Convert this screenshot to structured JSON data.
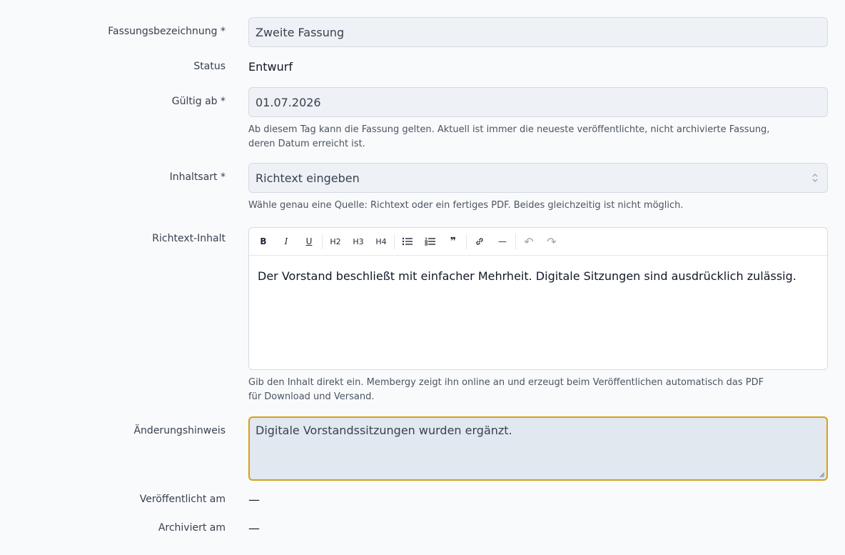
{
  "fields": {
    "name": {
      "label": "Fassungsbezeichnung *",
      "value": "Zweite Fassung"
    },
    "status": {
      "label": "Status",
      "value": "Entwurf"
    },
    "valid_from": {
      "label": "Gültig ab *",
      "value": "01.07.2026",
      "help_line1": "Ab diesem Tag kann die Fassung gelten. Aktuell ist immer die neueste veröffentlichte, nicht archivierte Fassung,",
      "help_line2": "deren Datum erreicht ist."
    },
    "content_type": {
      "label": "Inhaltsart *",
      "value": "Richtext eingeben",
      "help": "Wähle genau eine Quelle: Richtext oder ein fertiges PDF. Beides gleichzeitig ist nicht möglich."
    },
    "richtext": {
      "label": "Richtext-Inhalt",
      "toolbar": {
        "bold": "B",
        "italic": "I",
        "underline": "U",
        "h2": "H2",
        "h3": "H3",
        "h4": "H4",
        "bullet_icon": "bullet-list-icon",
        "ordered_icon": "ordered-list-icon",
        "quote": "❞",
        "link_icon": "link-icon",
        "hr": "—",
        "undo": "↶",
        "redo": "↷"
      },
      "content": "Der Vorstand beschließt mit einfacher Mehrheit. Digitale Sitzungen sind ausdrücklich zulässig.",
      "help_line1": "Gib den Inhalt direkt ein. Membergy zeigt ihn online an und erzeugt beim Veröffentlichen automatisch das PDF",
      "help_line2": "für Download und Versand."
    },
    "change_note": {
      "label": "Änderungshinweis",
      "value": "Digitale Vorstandssitzungen wurden ergänzt."
    },
    "published_at": {
      "label": "Veröffentlicht am",
      "value": "—"
    },
    "archived_at": {
      "label": "Archiviert am",
      "value": "—"
    }
  },
  "colors": {
    "accent_border": "#d4a017",
    "input_bg": "#eef1f5"
  }
}
